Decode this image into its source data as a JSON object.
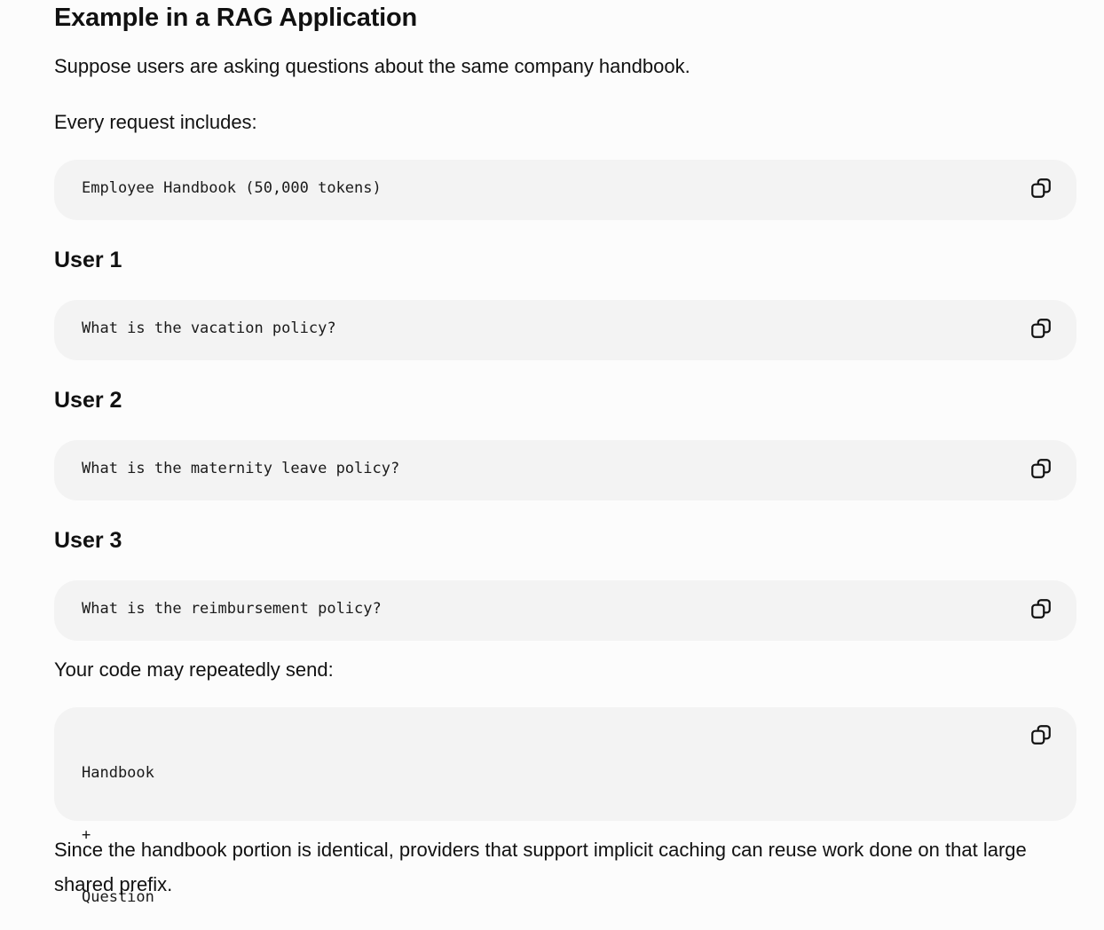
{
  "heading": "Example in a RAG Application",
  "intro": "Suppose users are asking questions about the same company handbook.",
  "every_request_label": "Every request includes:",
  "code_handbook": "Employee Handbook (50,000 tokens)",
  "users": [
    {
      "title": "User 1",
      "code": "What is the vacation policy?"
    },
    {
      "title": "User 2",
      "code": "What is the maternity leave policy?"
    },
    {
      "title": "User 3",
      "code": "What is the reimbursement policy?"
    }
  ],
  "repeat_label": "Your code may repeatedly send:",
  "repeat_code": [
    "Handbook",
    "+",
    "Question"
  ],
  "conclusion": "Since the handbook portion is identical, providers that support implicit caching can reuse work done on that large shared prefix.",
  "copy_icon": "copy-icon"
}
